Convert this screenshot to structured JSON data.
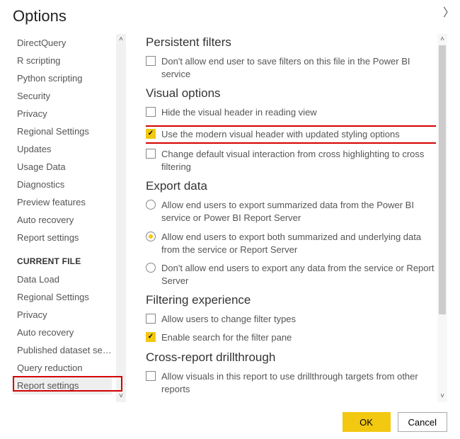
{
  "title": "Options",
  "sidebar": {
    "global": [
      "DirectQuery",
      "R scripting",
      "Python scripting",
      "Security",
      "Privacy",
      "Regional Settings",
      "Updates",
      "Usage Data",
      "Diagnostics",
      "Preview features",
      "Auto recovery",
      "Report settings"
    ],
    "currentFileHeader": "CURRENT FILE",
    "currentFile": [
      "Data Load",
      "Regional Settings",
      "Privacy",
      "Auto recovery",
      "Published dataset set...",
      "Query reduction",
      "Report settings"
    ],
    "selectedIndex": 6
  },
  "sections": {
    "persistent": {
      "title": "Persistent filters",
      "opt1": "Don't allow end user to save filters on this file in the Power BI service"
    },
    "visual": {
      "title": "Visual options",
      "opt1": "Hide the visual header in reading view",
      "opt2": "Use the modern visual header with updated styling options",
      "opt3": "Change default visual interaction from cross highlighting to cross filtering"
    },
    "export": {
      "title": "Export data",
      "opt1": "Allow end users to export summarized data from the Power BI service or Power BI Report Server",
      "opt2": "Allow end users to export both summarized and underlying data from the service or Report Server",
      "opt3": "Don't allow end users to export any data from the service or Report Server"
    },
    "filtering": {
      "title": "Filtering experience",
      "opt1": "Allow users to change filter types",
      "opt2": "Enable search for the filter pane"
    },
    "crossreport": {
      "title": "Cross-report drillthrough",
      "opt1": "Allow visuals in this report to use drillthrough targets from other reports"
    }
  },
  "buttons": {
    "ok": "OK",
    "cancel": "Cancel"
  }
}
